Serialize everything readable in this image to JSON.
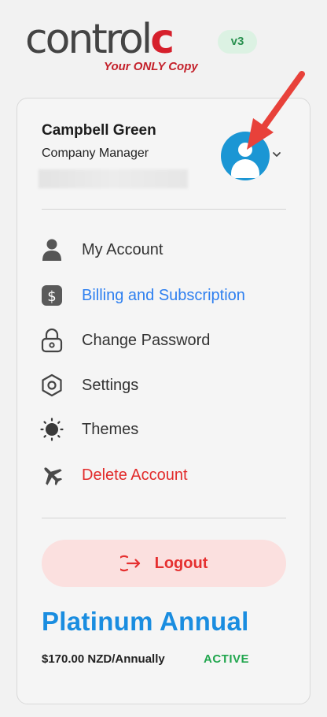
{
  "brand": {
    "wordmark_main": "control",
    "wordmark_accent": "c",
    "tagline": "Your ONLY Copy",
    "version": "v3",
    "accent_color": "#d6202c"
  },
  "user": {
    "name": "Campbell Green",
    "role": "Company Manager",
    "avatar_icon": "user-avatar-icon",
    "dropdown_icon": "chevron-down-icon"
  },
  "menu": {
    "items": [
      {
        "label": "My Account",
        "icon": "person-icon",
        "state": "default"
      },
      {
        "label": "Billing and Subscription",
        "icon": "dollar-icon",
        "state": "active"
      },
      {
        "label": "Change Password",
        "icon": "lock-icon",
        "state": "default"
      },
      {
        "label": "Settings",
        "icon": "settings-hexagon-icon",
        "state": "default"
      },
      {
        "label": "Themes",
        "icon": "sun-icon",
        "state": "default"
      },
      {
        "label": "Delete Account",
        "icon": "airplane-icon",
        "state": "danger"
      }
    ]
  },
  "logout": {
    "label": "Logout",
    "icon": "logout-arrow-icon"
  },
  "plan": {
    "name": "Platinum Annual",
    "price": "$170.00 NZD/Annually",
    "status": "ACTIVE"
  },
  "colors": {
    "active": "#2d7ff0",
    "danger": "#e22b2b",
    "plan": "#1a8de0",
    "status": "#21a64e",
    "avatar": "#1b96d4"
  }
}
